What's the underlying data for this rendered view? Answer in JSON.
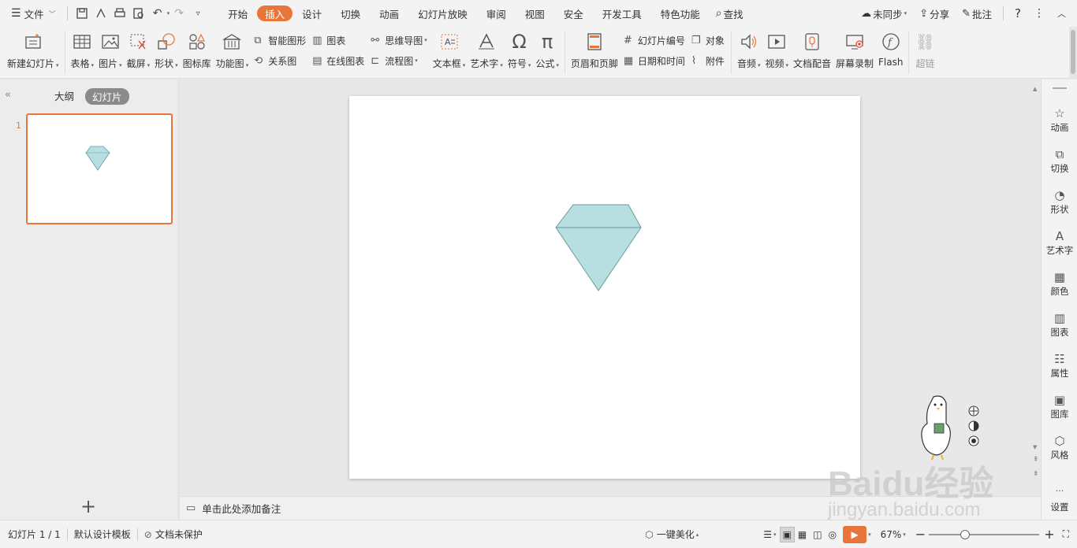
{
  "menubar": {
    "file_menu": "文件",
    "tabs": [
      {
        "label": "开始",
        "active": false
      },
      {
        "label": "插入",
        "active": true
      },
      {
        "label": "设计",
        "active": false
      },
      {
        "label": "切换",
        "active": false
      },
      {
        "label": "动画",
        "active": false
      },
      {
        "label": "幻灯片放映",
        "active": false
      },
      {
        "label": "审阅",
        "active": false
      },
      {
        "label": "视图",
        "active": false
      },
      {
        "label": "安全",
        "active": false
      },
      {
        "label": "开发工具",
        "active": false
      },
      {
        "label": "特色功能",
        "active": false
      }
    ],
    "search_label": "查找",
    "sync_label": "未同步",
    "share_label": "分享",
    "comment_label": "批注",
    "help_label": "?",
    "accent_color": "#e8763a"
  },
  "ribbon": {
    "new_slide": "新建幻灯片",
    "table": "表格",
    "picture": "图片",
    "screenshot": "截屏",
    "shape": "形状",
    "icon_library": "图标库",
    "function_chart": "功能图",
    "smart_art": "智能图形",
    "relation": "关系图",
    "chart": "图表",
    "online_chart": "在线图表",
    "mind_map": "思维导图",
    "flowchart": "流程图",
    "text_box": "文本框",
    "word_art": "艺术字",
    "symbol": "符号",
    "formula": "公式",
    "header_footer": "页眉和页脚",
    "slide_number": "幻灯片编号",
    "date_time": "日期和时间",
    "object": "对象",
    "attachment": "附件",
    "audio": "音频",
    "video": "视频",
    "doc_voice": "文档配音",
    "screen_record": "屏幕录制",
    "flash": "Flash",
    "hyperlink": "超链"
  },
  "left_panel": {
    "outline_tab": "大纲",
    "slides_tab": "幻灯片",
    "slide_number": "1"
  },
  "notes": {
    "placeholder": "单击此处添加备注"
  },
  "right_panel": {
    "items": [
      "动画",
      "切换",
      "形状",
      "艺术字",
      "颜色",
      "图表",
      "属性",
      "图库",
      "风格",
      "设置"
    ]
  },
  "statusbar": {
    "slide_info": "幻灯片 1 / 1",
    "template": "默认设计模板",
    "protection": "文档未保护",
    "beautify": "一键美化",
    "zoom": "67%"
  },
  "shape": {
    "fill": "#b7dfe2",
    "stroke": "#6a9aa0"
  },
  "watermark": {
    "brand": "Baidu经验",
    "url": "jingyan.baidu.com"
  }
}
